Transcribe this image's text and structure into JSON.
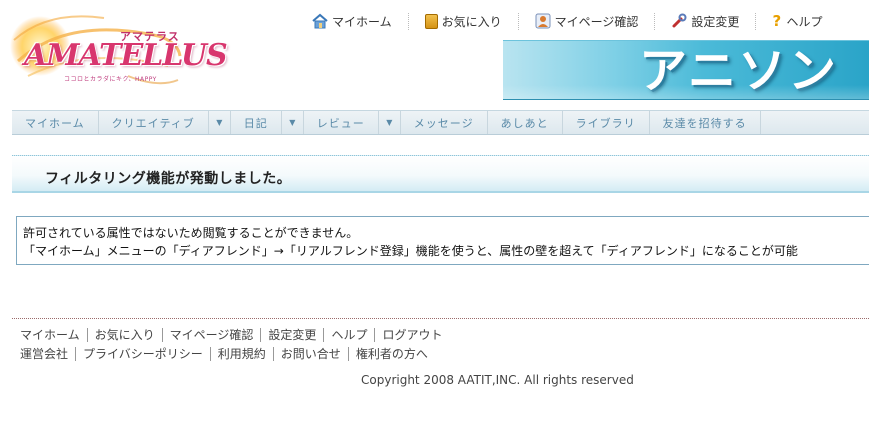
{
  "logo": {
    "kana": "アマテラス",
    "wordmark": "AMATELLUS",
    "tagline": "ココロとカラダにキク、HAPPY"
  },
  "topnav": [
    {
      "label": "マイホーム",
      "icon": "home-icon"
    },
    {
      "label": "お気に入り",
      "icon": "book-icon"
    },
    {
      "label": "マイページ確認",
      "icon": "person-icon"
    },
    {
      "label": "設定変更",
      "icon": "wrench-icon"
    },
    {
      "label": "ヘルプ",
      "icon": "help-icon"
    }
  ],
  "banner": {
    "title": "アニソン"
  },
  "mainnav": [
    {
      "label": "マイホーム"
    },
    {
      "label": "クリエイティブ"
    },
    {
      "label": "日記"
    },
    {
      "label": "レビュー"
    },
    {
      "label": "メッセージ"
    },
    {
      "label": "あしあと"
    },
    {
      "label": "ライブラリ"
    },
    {
      "label": "友達を招待する"
    }
  ],
  "notice": {
    "title": "フィルタリング機能が発動しました。"
  },
  "message": {
    "line1": "許可されている属性ではないため閲覧することができません。",
    "line2": "「マイホーム」メニューの「ディアフレンド」→「リアルフレンド登録」機能を使うと、属性の壁を超えて「ディアフレンド」になることが可能"
  },
  "footer": {
    "row1": [
      "マイホーム",
      "お気に入り",
      "マイページ確認",
      "設定変更",
      "ヘルプ",
      "ログアウト"
    ],
    "row2": [
      "運営会社",
      "プライバシーポリシー",
      "利用規約",
      "お問い合せ",
      "権利者の方へ"
    ],
    "copyright": "Copyright 2008 AATIT,INC. All rights reserved"
  },
  "colors": {
    "banner_accent": "#2aa4c8",
    "nav_text": "#5a8aa8",
    "logo_pink": "#d8366e"
  }
}
